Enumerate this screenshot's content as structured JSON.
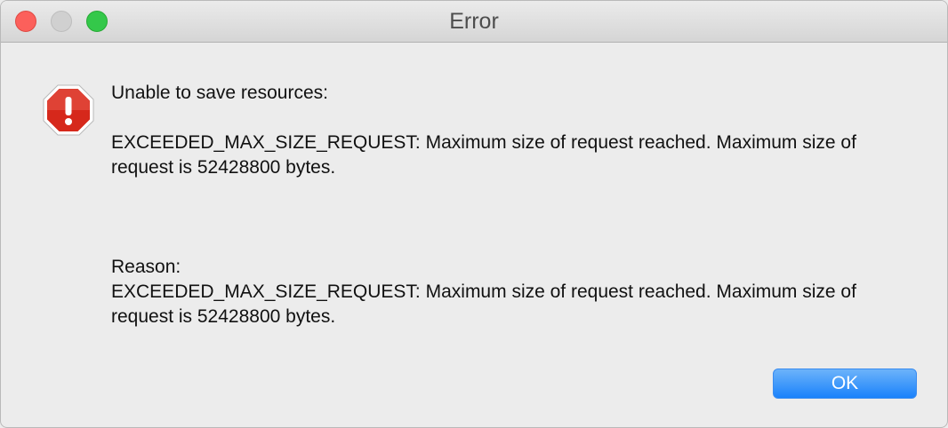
{
  "window": {
    "title": "Error"
  },
  "alert": {
    "icon": "exclamation-octagon-icon",
    "icon_color": "#d6281b",
    "heading": "Unable to save resources:",
    "detail": "EXCEEDED_MAX_SIZE_REQUEST: Maximum size of request reached. Maximum size of request is 52428800 bytes.",
    "reason_label": "Reason:",
    "reason": "EXCEEDED_MAX_SIZE_REQUEST: Maximum size of request reached. Maximum size of request is 52428800 bytes."
  },
  "buttons": {
    "ok_label": "OK",
    "ok_color": "#1a82fb"
  }
}
